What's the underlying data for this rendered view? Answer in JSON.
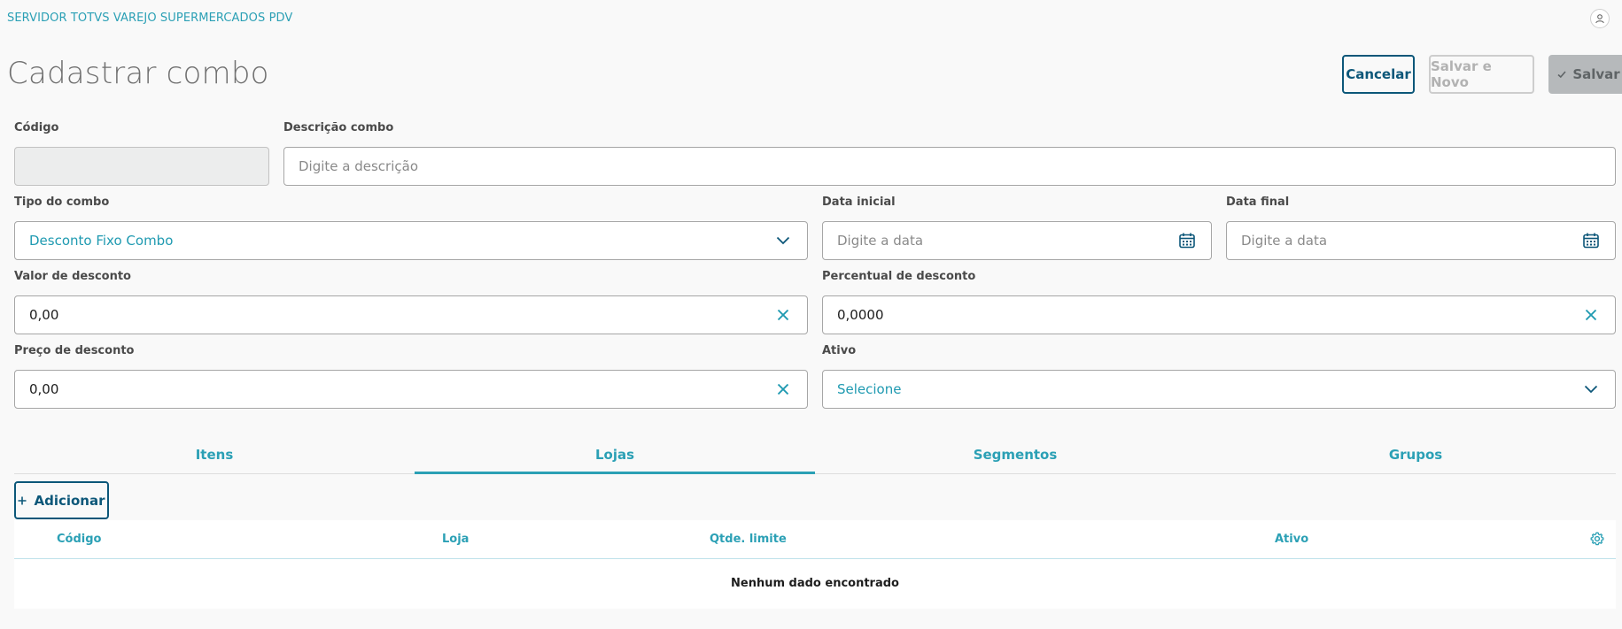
{
  "header": {
    "brand": "SERVIDOR TOTVS VAREJO SUPERMERCADOS PDV"
  },
  "page": {
    "title": "Cadastrar combo"
  },
  "actions": {
    "cancel": "Cancelar",
    "save_new": "Salvar e Novo",
    "save": "Salvar",
    "save_icon": "check-icon"
  },
  "form": {
    "codigo": {
      "label": "Código",
      "value": ""
    },
    "descricao": {
      "label": "Descrição combo",
      "placeholder": "Digite a descrição"
    },
    "tipo": {
      "label": "Tipo do combo",
      "selected": "Desconto Fixo Combo"
    },
    "data_inicial": {
      "label": "Data inicial",
      "placeholder": "Digite a data"
    },
    "data_final": {
      "label": "Data final",
      "placeholder": "Digite a data"
    },
    "valor_desconto": {
      "label": "Valor de desconto",
      "value": "0,00"
    },
    "percentual_desconto": {
      "label": "Percentual de desconto",
      "value": "0,0000"
    },
    "preco_desconto": {
      "label": "Preço de desconto",
      "value": "0,00"
    },
    "ativo": {
      "label": "Ativo",
      "selected": "Selecione"
    }
  },
  "tabs": [
    {
      "label": "Itens",
      "active": false
    },
    {
      "label": "Lojas",
      "active": true
    },
    {
      "label": "Segmentos",
      "active": false
    },
    {
      "label": "Grupos",
      "active": false
    }
  ],
  "table": {
    "add_button": "Adicionar",
    "columns": [
      "Código",
      "Loja",
      "Qtde. limite",
      "Ativo"
    ],
    "empty_message": "Nenhum dado encontrado"
  },
  "colors": {
    "accent": "#2ba0b5",
    "primary": "#0c5779",
    "disabled_bg": "#b6b9bb"
  }
}
